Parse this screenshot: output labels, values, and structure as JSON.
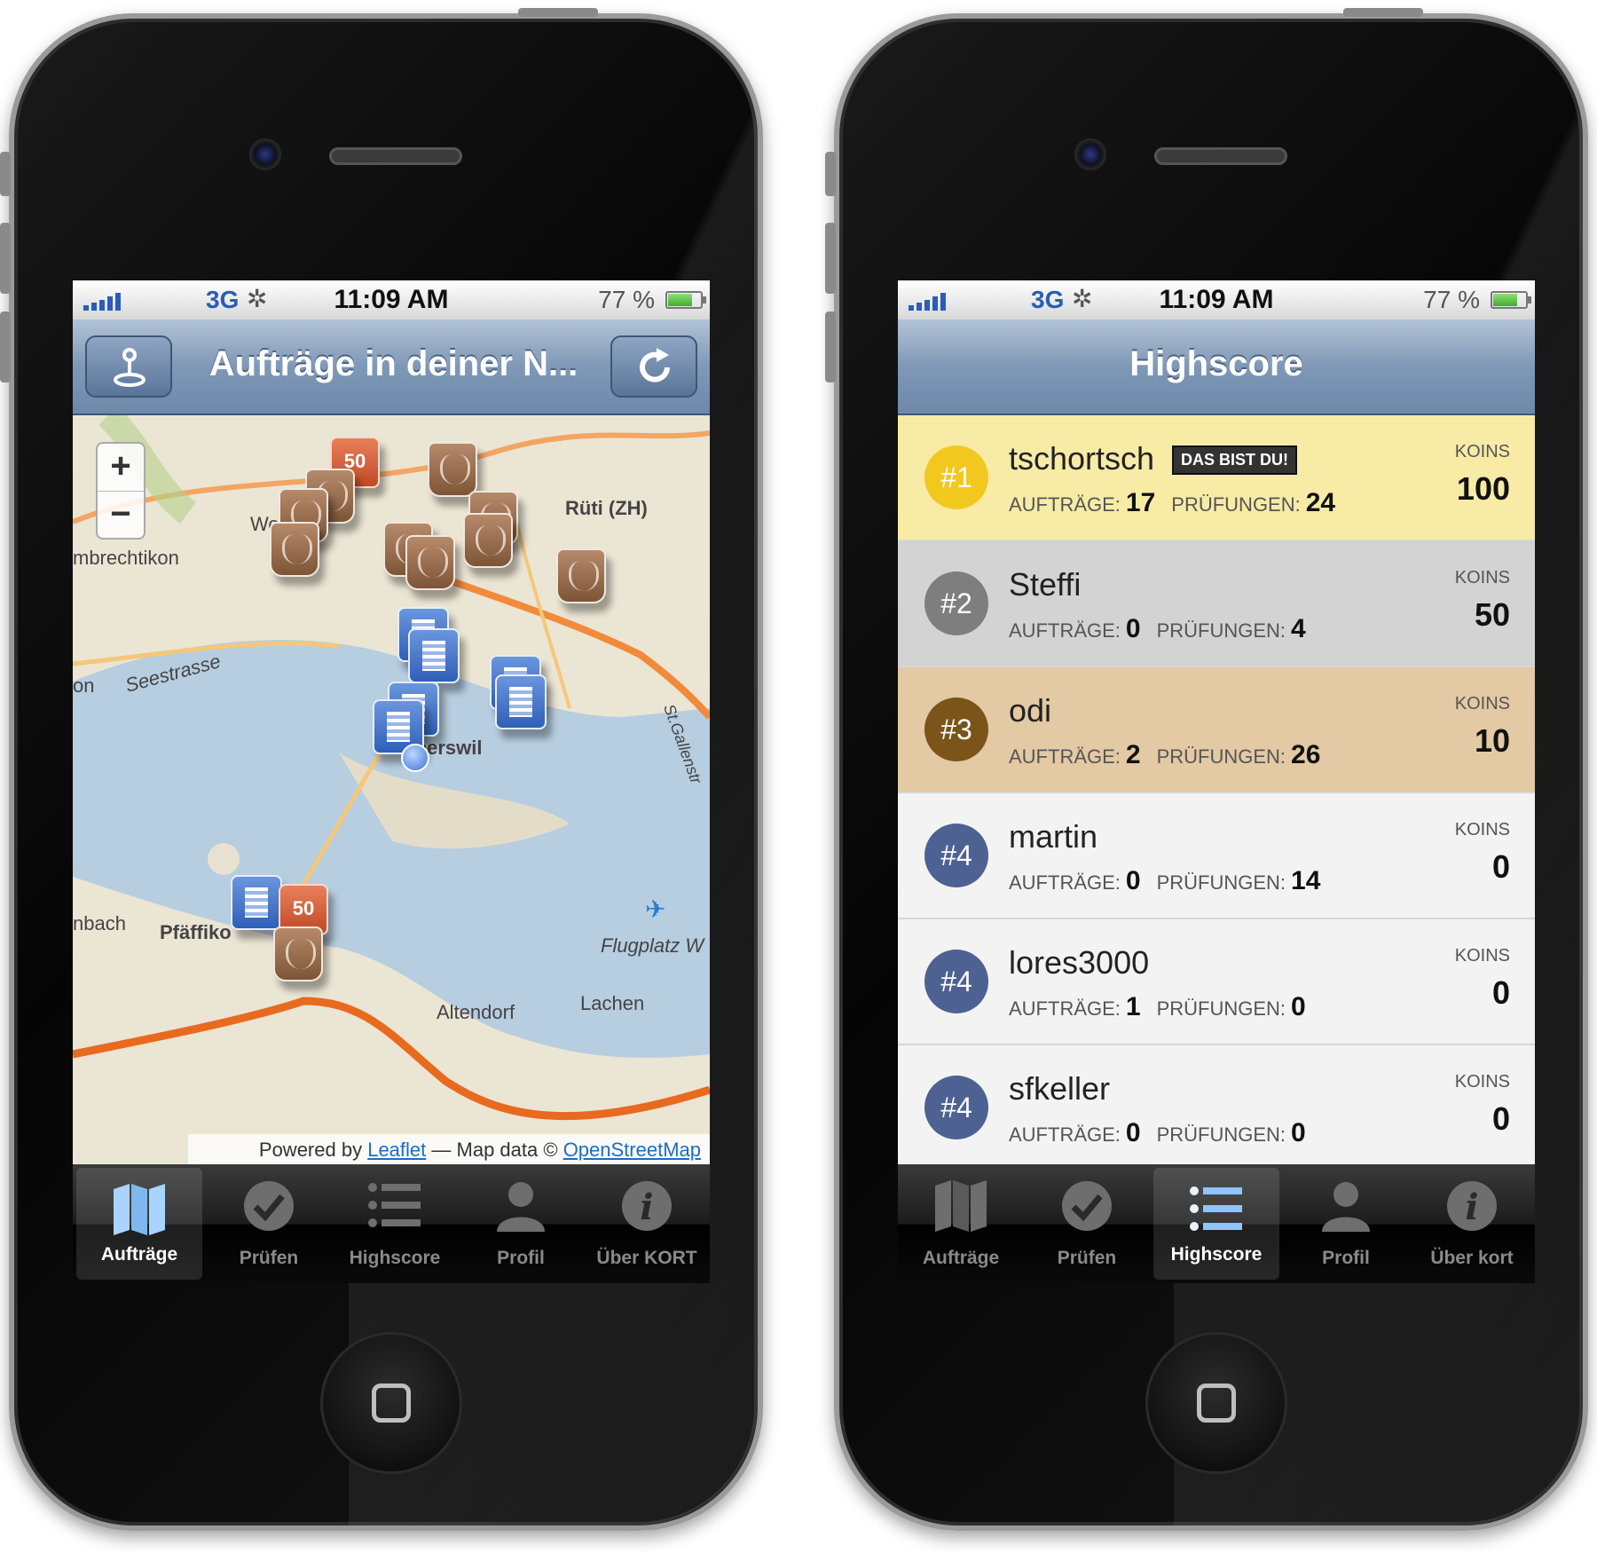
{
  "left_screen": {
    "status": {
      "network": "3G",
      "time": "11:09 AM",
      "battery": "77 %",
      "battery_level": 77
    },
    "navbar": {
      "title": "Aufträge in deiner N..."
    },
    "map": {
      "zoom_in": "+",
      "zoom_out": "−",
      "places": [
        "Rüti (ZH)",
        "Wo",
        "mbrechtikon",
        "on",
        "Seestrasse",
        "apperswil",
        "nbach",
        "Pfäffiko",
        "Flugplatz W",
        "Lachen",
        "Altendorf",
        "St.Gallenstr"
      ],
      "speed_sign": "50",
      "attribution": {
        "prefix": "Powered by",
        "leaflet": "Leaflet",
        "middle": "— Map data ©",
        "osm": "OpenStreetMap"
      }
    },
    "tabs": [
      {
        "label": "Aufträge",
        "icon": "map-icon"
      },
      {
        "label": "Prüfen",
        "icon": "check-icon"
      },
      {
        "label": "Highscore",
        "icon": "list-icon"
      },
      {
        "label": "Profil",
        "icon": "user-icon"
      },
      {
        "label": "Über KORT",
        "icon": "info-icon"
      }
    ]
  },
  "right_screen": {
    "status": {
      "network": "3G",
      "time": "11:09 AM",
      "battery": "77 %",
      "battery_level": 77
    },
    "navbar": {
      "title": "Highscore"
    },
    "labels": {
      "auftraege": "AUFTRÄGE:",
      "pruefungen": "PRÜFUNGEN:",
      "koins": "KOINS"
    },
    "rows": [
      {
        "rank": "#1",
        "name": "tschortsch",
        "badge": "DAS BIST DU!",
        "auftraege": "17",
        "pruefungen": "24",
        "koins": "100",
        "bg": "#f7eba6",
        "circle": "#f2c81f"
      },
      {
        "rank": "#2",
        "name": "Steffi",
        "auftraege": "0",
        "pruefungen": "4",
        "koins": "50",
        "bg": "#d3d3d3",
        "circle": "#7e7e7e"
      },
      {
        "rank": "#3",
        "name": "odi",
        "auftraege": "2",
        "pruefungen": "26",
        "koins": "10",
        "bg": "#e3c9a4",
        "circle": "#7a5419"
      },
      {
        "rank": "#4",
        "name": "martin",
        "auftraege": "0",
        "pruefungen": "14",
        "koins": "0",
        "bg": "#f3f3f3",
        "circle": "#4d6192"
      },
      {
        "rank": "#4",
        "name": "lores3000",
        "auftraege": "1",
        "pruefungen": "0",
        "koins": "0",
        "bg": "#f3f3f3",
        "circle": "#4d6192"
      },
      {
        "rank": "#4",
        "name": "sfkeller",
        "auftraege": "0",
        "pruefungen": "0",
        "koins": "0",
        "bg": "#f3f3f3",
        "circle": "#4d6192"
      }
    ],
    "tabs": [
      {
        "label": "Aufträge",
        "icon": "map-icon"
      },
      {
        "label": "Prüfen",
        "icon": "check-icon"
      },
      {
        "label": "Highscore",
        "icon": "list-icon"
      },
      {
        "label": "Profil",
        "icon": "user-icon"
      },
      {
        "label": "Über kort",
        "icon": "info-icon"
      }
    ]
  }
}
